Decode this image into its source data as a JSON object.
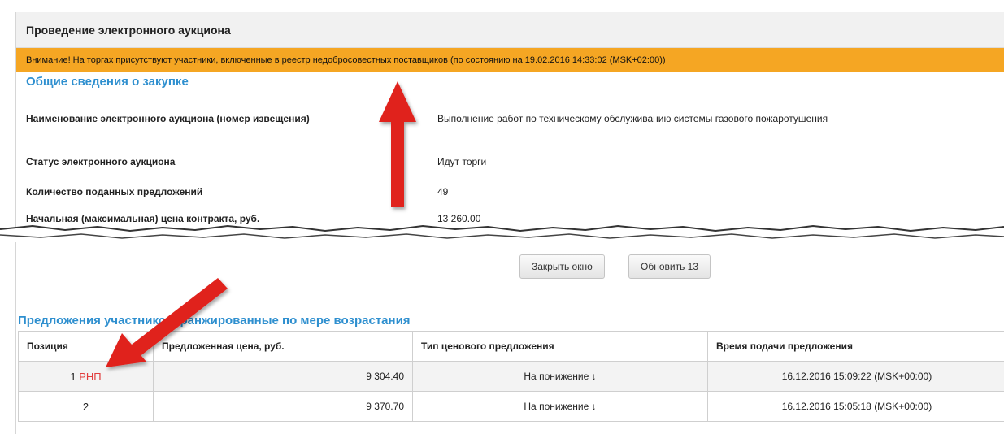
{
  "header": {
    "title": "Проведение электронного аукциона"
  },
  "warning": {
    "text": "Внимание! На торгах присутствуют участники, включенные в реестр недобросовестных поставщиков (по состоянию на 19.02.2016 14:33:02 (MSK+02:00))"
  },
  "general": {
    "title": "Общие сведения о закупке",
    "rows": [
      {
        "label": "Наименование электронного аукциона (номер извещения)",
        "value": "Выполнение работ по техническому обслуживанию системы газового пожаротушения"
      },
      {
        "label": "Статус электронного аукциона",
        "value": "Идут торги"
      },
      {
        "label": "Количество поданных предложений",
        "value": "49"
      },
      {
        "label": "Начальная (максимальная) цена контракта, руб.",
        "value": "13 260.00"
      }
    ]
  },
  "buttons": {
    "close": "Закрыть окно",
    "refresh": "Обновить 13"
  },
  "offers": {
    "title": "Предложения участников, ранжированные по мере возрастания",
    "columns": [
      "Позиция",
      "Предложенная цена, руб.",
      "Тип ценового предложения",
      "Время подачи предложения"
    ],
    "rows": [
      {
        "position": "1",
        "badge": "РНП",
        "price": "9 304.40",
        "type": "На понижение ↓",
        "time": "16.12.2016 15:09:22 (MSK+00:00)"
      },
      {
        "position": "2",
        "badge": "",
        "price": "9 370.70",
        "type": "На понижение ↓",
        "time": "16.12.2016 15:05:18 (MSK+00:00)"
      }
    ]
  },
  "colors": {
    "warning_bg": "#f5a623",
    "accent": "#2e8fcf",
    "badge": "#e23c3c",
    "arrow": "#e0201c"
  }
}
